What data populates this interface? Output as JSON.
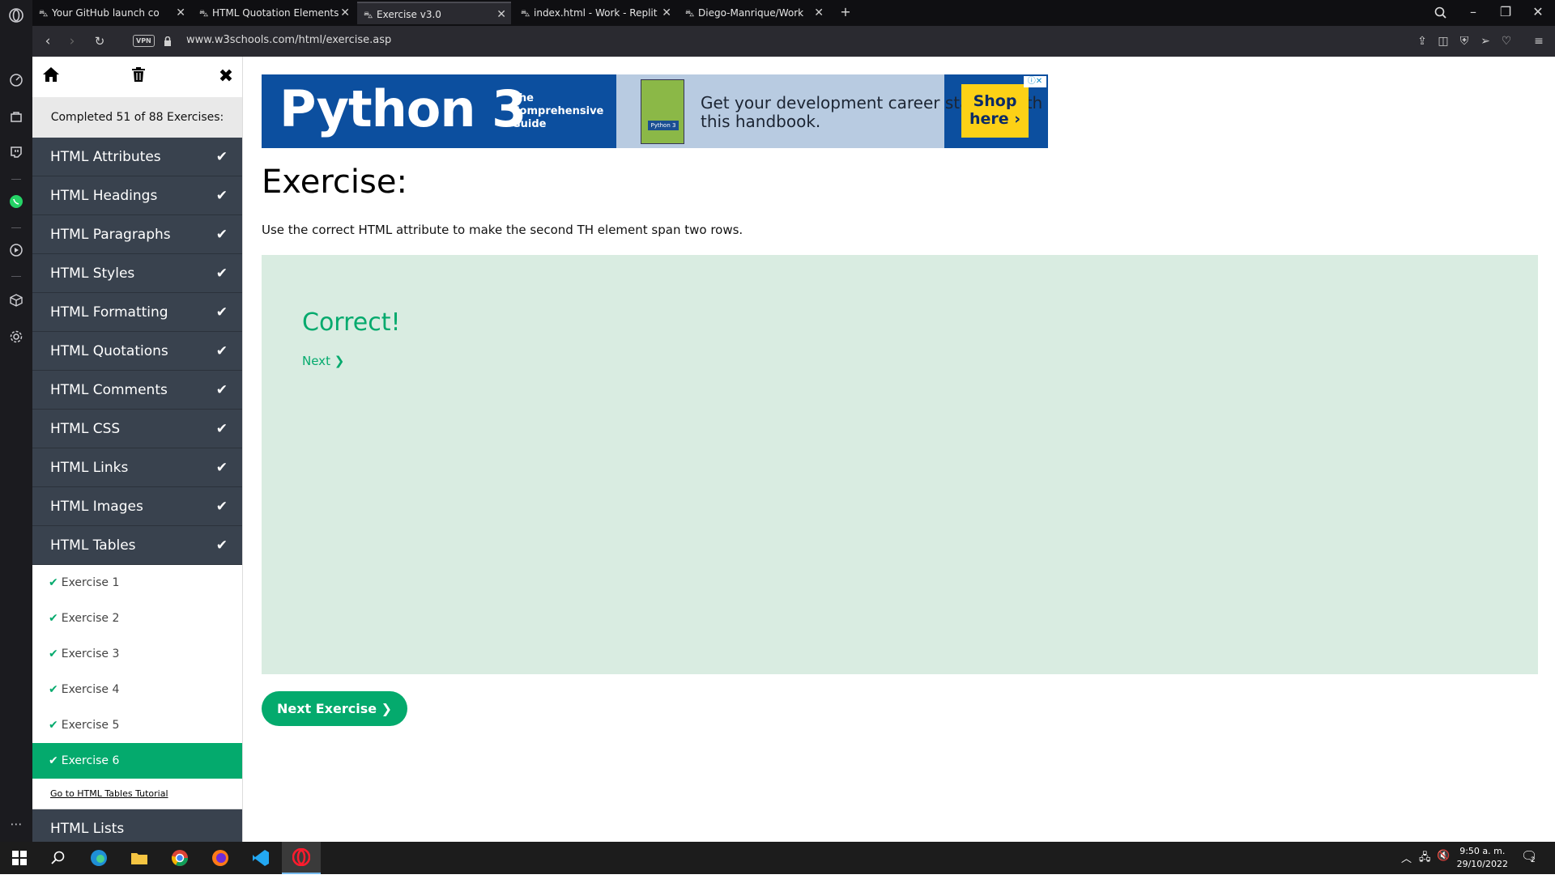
{
  "browser": {
    "tabs": [
      {
        "label": "Your GitHub launch co",
        "active": false
      },
      {
        "label": "HTML Quotation Elements",
        "active": false
      },
      {
        "label": "Exercise v3.0",
        "active": true
      },
      {
        "label": "index.html - Work - Replit",
        "active": false
      },
      {
        "label": "Diego-Manrique/Work",
        "active": false
      }
    ],
    "new_tab_label": "+",
    "vpn_label": "VPN",
    "url": "www.w3schools.com/html/exercise.asp"
  },
  "sidebar": {
    "completed_text": "Completed 51 of 88 Exercises:",
    "chapters_done": [
      {
        "label": "HTML Attributes"
      },
      {
        "label": "HTML Headings"
      },
      {
        "label": "HTML Paragraphs"
      },
      {
        "label": "HTML Styles"
      },
      {
        "label": "HTML Formatting"
      },
      {
        "label": "HTML Quotations"
      },
      {
        "label": "HTML Comments"
      },
      {
        "label": "HTML CSS"
      },
      {
        "label": "HTML Links"
      },
      {
        "label": "HTML Images"
      },
      {
        "label": "HTML Tables"
      }
    ],
    "exercises": [
      {
        "label": "Exercise 1"
      },
      {
        "label": "Exercise 2"
      },
      {
        "label": "Exercise 3"
      },
      {
        "label": "Exercise 4"
      },
      {
        "label": "Exercise 5"
      },
      {
        "label": "Exercise 6"
      }
    ],
    "tutorial_link": "Go to HTML Tables Tutorial",
    "next_chapter": "HTML Lists"
  },
  "ad": {
    "headline": "Python 3",
    "subline": "The Comprehensive Guide",
    "book_label": "Python 3",
    "body": "Get your development career started with this handbook.",
    "cta": "Shop here ›"
  },
  "exercise": {
    "title": "Exercise:",
    "instruction": "Use the correct HTML attribute to make the second TH element span two rows.",
    "result": "Correct!",
    "next_link": "Next ❯",
    "next_button": "Next Exercise ❯"
  },
  "taskbar": {
    "time": "9:50 a. m.",
    "date": "29/10/2022",
    "notification_count": "2"
  },
  "colors": {
    "accent_green": "#04aa6d",
    "sidebar_dark": "#39424e",
    "result_bg": "#d9ece1",
    "ad_blue": "#0c4f9f",
    "ad_yellow": "#fcd116"
  }
}
